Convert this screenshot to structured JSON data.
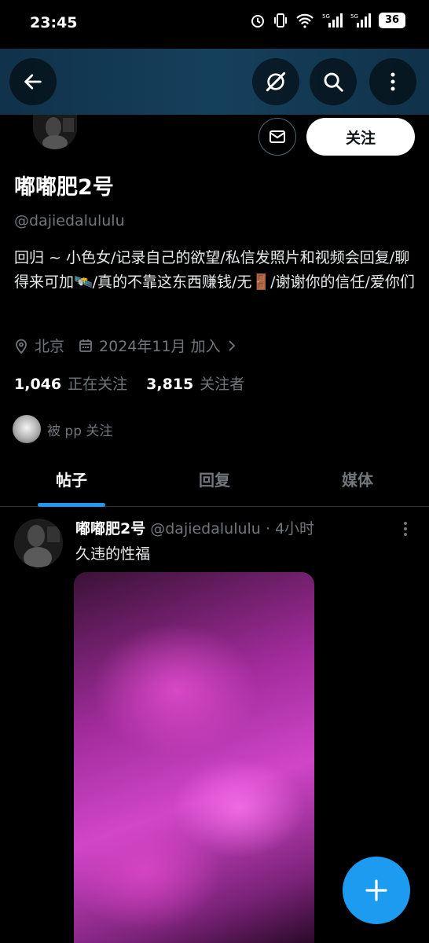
{
  "status_bar": {
    "time": "23:45",
    "battery": "36"
  },
  "profile": {
    "name": "嘟嘟肥2号",
    "handle": "@dajiedalululu",
    "bio": "回归 ~ 小色女/记录自己的欲望/私信发照片和视频会回复/聊得来可加🛰️/真的不靠这东西赚钱/无🚪/谢谢你的信任/爱你们",
    "location": "北京",
    "joined": "2024年11月 加入",
    "following_count": "1,046",
    "following_label": "正在关注",
    "followers_count": "3,815",
    "followers_label": "关注者",
    "followed_by": "被 pp 关注",
    "follow_button": "关注"
  },
  "tabs": [
    {
      "label": "帖子",
      "active": true
    },
    {
      "label": "回复",
      "active": false
    },
    {
      "label": "媒体",
      "active": false
    }
  ],
  "post": {
    "author_name": "嘟嘟肥2号",
    "author_handle": "@dajiedalululu · 4小时",
    "text": "久违的性福"
  },
  "colors": {
    "accent": "#1d9bf0",
    "background": "#000000",
    "muted": "#71767b",
    "topbar": "#15405c"
  },
  "icons": [
    "back-arrow-icon",
    "incognito-icon",
    "search-icon",
    "more-vertical-icon",
    "mail-icon",
    "location-icon",
    "calendar-icon",
    "chevron-right-icon",
    "plus-icon"
  ]
}
